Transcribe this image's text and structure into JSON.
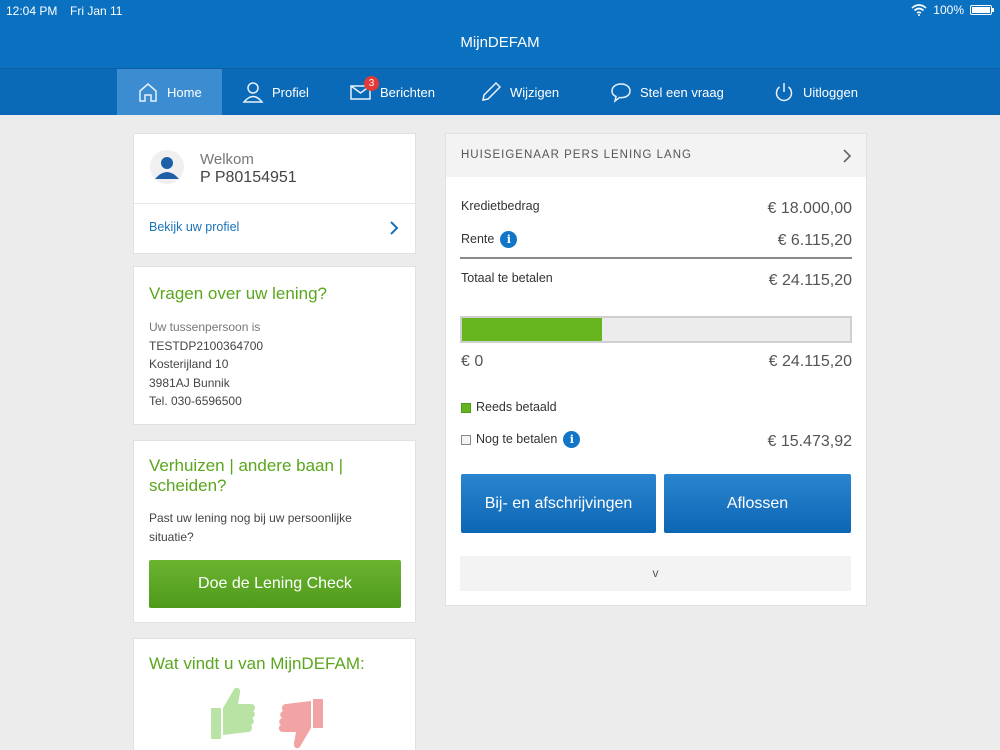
{
  "status": {
    "time": "12:04 PM",
    "date": "Fri Jan 11",
    "battery": "100%"
  },
  "app": {
    "title": "MijnDEFAM"
  },
  "nav": {
    "home": "Home",
    "profile": "Profiel",
    "messages": "Berichten",
    "messages_badge": "3",
    "edit": "Wijzigen",
    "ask": "Stel een vraag",
    "logout": "Uitloggen"
  },
  "welcome": {
    "label": "Welkom",
    "user_id": "P P80154951",
    "profile_link": "Bekijk uw profiel"
  },
  "questions": {
    "title": "Vragen over uw lening?",
    "intro": "Uw tussenpersoon is",
    "name": "TESTDP2100364700",
    "street": "Kosterijland 10",
    "city": "3981AJ Bunnik",
    "phone": "Tel. 030-6596500"
  },
  "change": {
    "title": "Verhuizen | andere baan | scheiden?",
    "text": "Past uw lening nog bij uw persoonlijke situatie?",
    "button": "Doe de Lening Check"
  },
  "feedback": {
    "title": "Wat vindt u van MijnDEFAM:"
  },
  "loan": {
    "name": "HUISEIGENAAR PERS LENING LANG",
    "credit_label": "Kredietbedrag",
    "credit_value": "€ 18.000,00",
    "interest_label": "Rente",
    "interest_value": "€ 6.115,20",
    "total_label": "Totaal te betalen",
    "total_value": "€ 24.115,20",
    "progress_paid_fraction": 0.36,
    "scale_min": "€ 0",
    "scale_max": "€ 24.115,20",
    "paid_label": "Reeds betaald",
    "remaining_label": "Nog te betalen",
    "remaining_value": "€ 15.473,92",
    "btn_transactions": "Bij- en afschrijvingen",
    "btn_repay": "Aflossen",
    "expand_label": "v"
  },
  "colors": {
    "primary_blue": "#0a70c0",
    "green": "#5aa61d",
    "progress_green": "#66b51e"
  }
}
